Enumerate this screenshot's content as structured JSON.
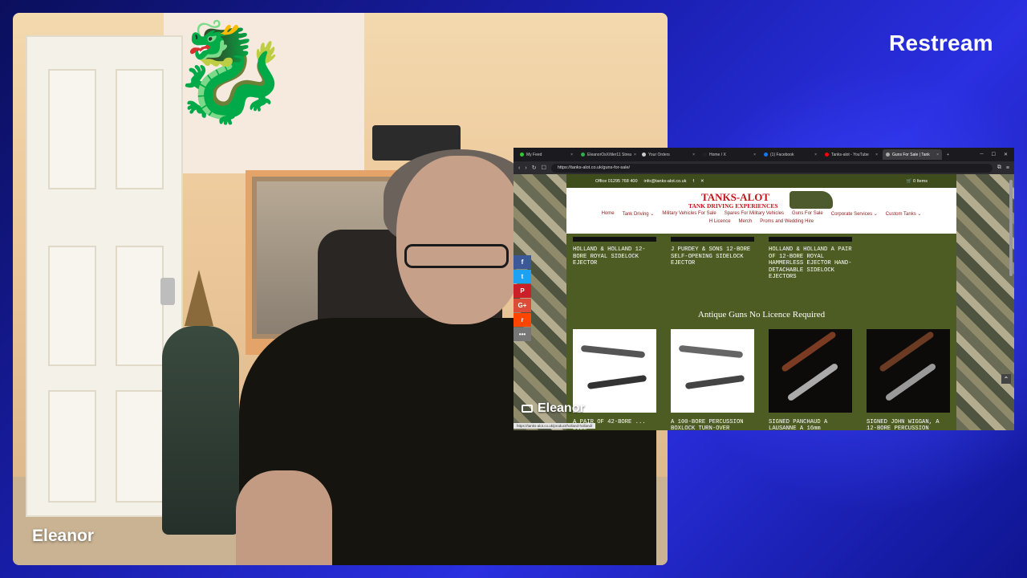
{
  "brand": "Restream",
  "webcam": {
    "participant_name": "Eleanor"
  },
  "screenshare": {
    "participant_name": "Eleanor",
    "browser": {
      "tabs": [
        {
          "label": "My Feed",
          "color": "#37c537"
        },
        {
          "label": "EleanorOsX/tiler11 Strea",
          "color": "#2bb04a"
        },
        {
          "label": "Your Orders",
          "color": "#cccccc"
        },
        {
          "label": "Home / X",
          "color": "#222222"
        },
        {
          "label": "(1) Facebook",
          "color": "#1877f2"
        },
        {
          "label": "Tanks-alot - YouTube",
          "color": "#ff0000"
        },
        {
          "label": "Guns For Sale | Tank",
          "color": "#aaaaaa",
          "active": true
        }
      ],
      "url": "https://tanks-alot.co.uk/guns-for-sale/",
      "status_url": "https://tanks-alot.co.uk/product/holland-holland/"
    },
    "site": {
      "topbar": {
        "phone": "Office 01295 768 400",
        "email": "info@tanks-alot.co.uk",
        "cart": "0 Items"
      },
      "logo_line1": "TANKS-ALOT",
      "logo_line2": "TANK DRIVING EXPERIENCES",
      "nav": [
        "Home",
        "Tank Driving ⌄",
        "Military Vehicles For Sale",
        "Spares For Military Vehicles",
        "Guns For Sale",
        "Corporate Services ⌄",
        "Custom Tanks ⌄",
        "H Licence",
        "Merch",
        "Proms and Wedding Hire"
      ],
      "products_row1": [
        "HOLLAND & HOLLAND 12-BORE ROYAL SIDELOCK EJECTOR",
        "J PURDEY & SONS 12-BORE SELF-OPENING SIDELOCK EJECTOR",
        "HOLLAND & HOLLAND A PAIR OF 12-BORE ROYAL HAMMERLESS EJECTOR HAND-DETACHABLE SIDELOCK EJECTORS"
      ],
      "section_heading": "Antique Guns No Licence Required",
      "products_row2": [
        "A PAIR OF 42-BORE ... SIDE-",
        "A 100-BORE PERCUSSION BOXLOCK TURN-OVER",
        "SIGNED PANCHAUD A LAUSANNE A 16mm",
        "SIGNED JOHN WIGGAN, A 12-BORE PERCUSSION"
      ],
      "social_buttons": [
        {
          "label": "f",
          "color": "#3b5998"
        },
        {
          "label": "t",
          "color": "#1da1f2"
        },
        {
          "label": "P",
          "color": "#cb2027"
        },
        {
          "label": "G+",
          "color": "#dd4b39"
        },
        {
          "label": "r",
          "color": "#ff4500"
        },
        {
          "label": "•••",
          "color": "#777777"
        }
      ]
    }
  }
}
